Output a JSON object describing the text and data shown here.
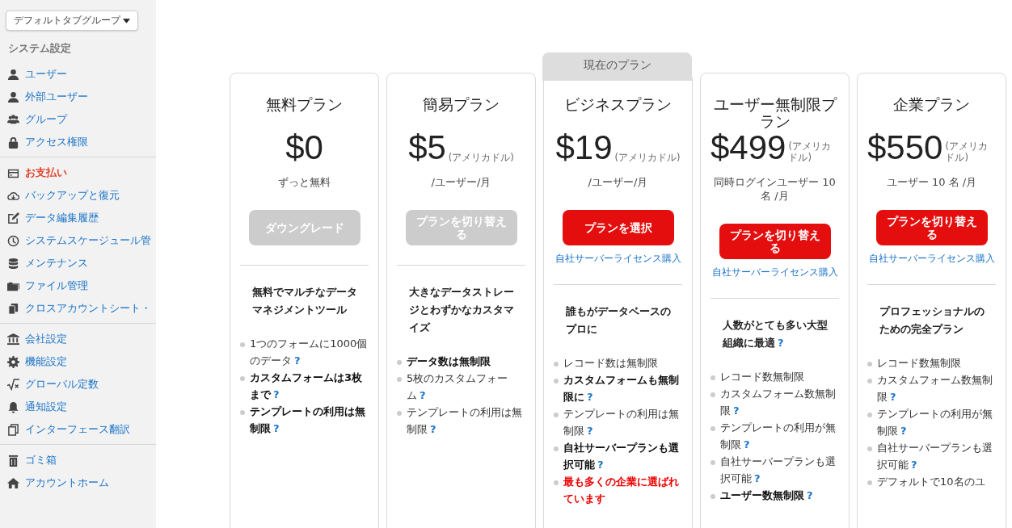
{
  "tab_group_dropdown": "デフォルトタブグループ",
  "sidebar": {
    "heading": "システム設定",
    "groups": [
      [
        {
          "label": "ユーザー",
          "selected": false
        },
        {
          "label": "外部ユーザー",
          "selected": false
        },
        {
          "label": "グループ",
          "selected": false
        },
        {
          "label": "アクセス権限",
          "selected": false
        }
      ],
      [
        {
          "label": "お支払い",
          "selected": true
        },
        {
          "label": "バックアップと復元",
          "selected": false
        },
        {
          "label": "データ編集履歴",
          "selected": false
        },
        {
          "label": "システムスケージュール管",
          "selected": false
        },
        {
          "label": "メンテナンス",
          "selected": false
        },
        {
          "label": "ファイル管理",
          "selected": false
        },
        {
          "label": "クロスアカウントシート・",
          "selected": false
        }
      ],
      [
        {
          "label": "会社設定",
          "selected": false
        },
        {
          "label": "機能設定",
          "selected": false
        },
        {
          "label": "グローバル定数",
          "selected": false
        },
        {
          "label": "通知設定",
          "selected": false
        },
        {
          "label": "インターフェース翻訳",
          "selected": false
        }
      ],
      [
        {
          "label": "ゴミ箱",
          "selected": false
        },
        {
          "label": "アカウントホーム",
          "selected": false
        }
      ]
    ]
  },
  "plans": [
    {
      "title": "無料プラン",
      "price": "$0",
      "per": "ずっと無料",
      "button": {
        "label": "ダウングレード",
        "disabled": true
      },
      "tagline": "無料でマルチなデータマネジメントツール",
      "tagline_help": false,
      "features": [
        {
          "text": "1つのフォームに1000個のデータ",
          "bold": false,
          "help": true
        },
        {
          "text": "カスタムフォームは3枚まで",
          "bold": true,
          "help": true
        },
        {
          "text": "テンプレートの利用は無制限",
          "bold": true,
          "help": true
        }
      ]
    },
    {
      "title": "簡易プラン",
      "price": "$5",
      "unit": "(アメリカドル)",
      "per": "/ユーザー/月",
      "button": {
        "label": "プランを切り替える",
        "disabled": true
      },
      "tagline": "大きなデータストレージとわずかなカスタマイズ",
      "tagline_help": false,
      "features": [
        {
          "text": "データ数は無制限",
          "bold": true,
          "help": false
        },
        {
          "text": "5枚のカスタムフォーム",
          "bold": false,
          "help": true
        },
        {
          "text": "テンプレートの利用は無制限",
          "bold": false,
          "help": true
        }
      ]
    },
    {
      "banner": "現在のプラン",
      "title": "ビジネスプラン",
      "price": "$19",
      "unit": "(アメリカドル)",
      "per": "/ユーザー/月",
      "button": {
        "label": "プランを選択",
        "disabled": false
      },
      "link": "自社サーバーライセンス購入",
      "tagline": "誰もがデータベースのプロに",
      "tagline_help": false,
      "features": [
        {
          "text": "レコード数は無制限",
          "bold": false,
          "help": false
        },
        {
          "text": "カスタムフォームも無制限に",
          "bold": true,
          "help": true
        },
        {
          "text": "テンプレートの利用は無制限",
          "bold": false,
          "help": true
        },
        {
          "text": "自社サーバープランも選択可能",
          "bold": true,
          "help": true
        },
        {
          "text": "最も多くの企業に選ばれています",
          "bold": true,
          "help": false,
          "highlight": true
        }
      ]
    },
    {
      "title": "ユーザー無制限プラン",
      "price": "$499",
      "unit": "(アメリカドル)",
      "per": "同時ログインユーザー 10 名 /月",
      "button": {
        "label": "プランを切り替える",
        "disabled": false
      },
      "link": "自社サーバーライセンス購入",
      "tagline": "人数がとても多い大型組織に最適",
      "tagline_help": true,
      "features": [
        {
          "text": "レコード数無制限",
          "bold": false,
          "help": false
        },
        {
          "text": "カスタムフォーム数無制限",
          "bold": false,
          "help": true
        },
        {
          "text": "テンプレートの利用が無制限",
          "bold": false,
          "help": true
        },
        {
          "text": "自社サーバープランも選択可能",
          "bold": false,
          "help": true
        },
        {
          "text": "ユーザー数無制限",
          "bold": true,
          "help": true
        }
      ]
    },
    {
      "title": "企業プラン",
      "price": "$550",
      "unit": "(アメリカドル)",
      "per": "ユーザー 10 名 /月",
      "button": {
        "label": "プランを切り替える",
        "disabled": false
      },
      "link": "自社サーバーライセンス購入",
      "tagline": "プロフェッショナルのための完全プラン",
      "tagline_help": false,
      "features": [
        {
          "text": "レコード数無制限",
          "bold": false,
          "help": false
        },
        {
          "text": "カスタムフォーム数無制限",
          "bold": false,
          "help": true
        },
        {
          "text": "テンプレートの利用が無制限",
          "bold": false,
          "help": true
        },
        {
          "text": "自社サーバープランも選択可能",
          "bold": false,
          "help": true
        },
        {
          "text": "デフォルトで10名のユ",
          "bold": false,
          "help": false
        }
      ]
    }
  ],
  "help_mark": "?"
}
